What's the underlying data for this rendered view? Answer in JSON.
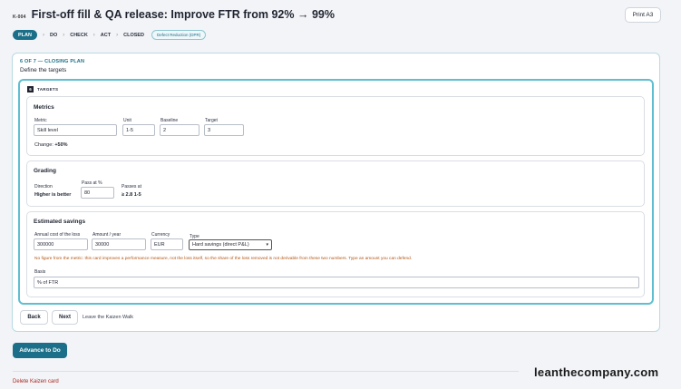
{
  "header": {
    "id": "K-004",
    "title": "First-off fill & QA release: Improve FTR from 92% → 99%",
    "print_label": "Print A3"
  },
  "stepper": {
    "active": "PLAN",
    "steps": [
      "DO",
      "CHECK",
      "ACT",
      "CLOSED"
    ],
    "tag": "Defect Reduction (DPR)"
  },
  "section": {
    "counter": "6 OF 7 — CLOSING PLAN",
    "subtitle": "Define the targets",
    "targets_index": "6",
    "targets_label": "TARGETS"
  },
  "metrics": {
    "title": "Metrics",
    "metric_label": "Metric",
    "metric_value": "Skill level",
    "unit_label": "Unit",
    "unit_value": "1-5",
    "baseline_label": "Baseline",
    "baseline_value": "2",
    "target_label": "Target",
    "target_value": "3",
    "change_prefix": "Change:",
    "change_value": "+50%"
  },
  "grading": {
    "title": "Grading",
    "direction_label": "Direction",
    "direction_value": "Higher is better",
    "pass_label": "Pass at %",
    "pass_value": "80",
    "passes_label": "Passes at",
    "passes_value": "≥ 2.8 1-5"
  },
  "savings": {
    "title": "Estimated savings",
    "cost_label": "Annual cost of the loss",
    "cost_value": "300000",
    "amount_label": "Amount / year",
    "amount_value": "30000",
    "currency_label": "Currency",
    "currency_value": "EUR",
    "type_label": "Type",
    "type_value": "Hard savings (direct P&L)",
    "warning": "No figure from the metric: this card improves a performance measure, not the loss itself, so the share of the loss removed is not derivable from these two numbers. Type an amount you can defend.",
    "basis_label": "Basis",
    "basis_value": "% of FTR"
  },
  "nav": {
    "back": "Back",
    "next": "Next",
    "leave": "Leave the Kaizen Walk"
  },
  "footer": {
    "advance": "Advance to Do",
    "delete": "Delete Kaizen card",
    "watermark": "leanthecompany.com"
  }
}
